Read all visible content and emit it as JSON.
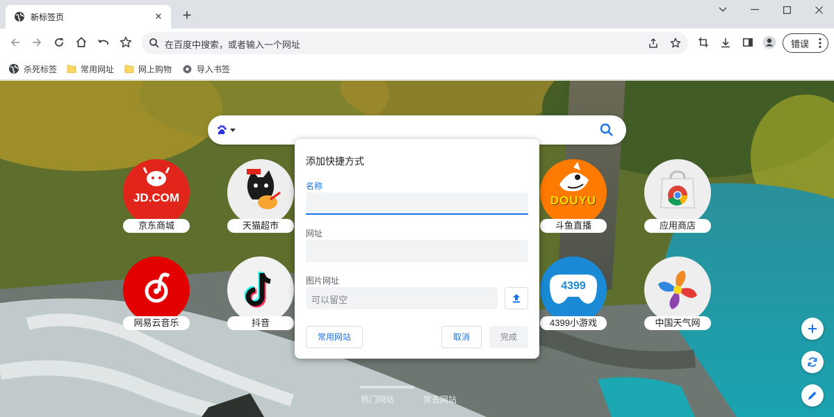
{
  "tab": {
    "title": "新标签页",
    "close": "✕"
  },
  "omnibox": {
    "placeholder": "在百度中搜索，或者输入一个网址"
  },
  "profile": {
    "error_label": "错误"
  },
  "bookmarks": [
    {
      "label": "杀死标签",
      "icon": "globe-icon"
    },
    {
      "label": "常用网址",
      "icon": "folder-icon"
    },
    {
      "label": "网上购物",
      "icon": "folder-icon"
    },
    {
      "label": "导入书签",
      "icon": "gear-icon"
    }
  ],
  "shortcuts": [
    {
      "name": "京东商城",
      "logo_text": "JD.COM",
      "color": "#e1251b"
    },
    {
      "name": "天猫超市",
      "color": "#eeeeee"
    },
    {
      "name": "斗鱼直播",
      "logo_text": "DOUYU",
      "color": "#ff7a00"
    },
    {
      "name": "应用商店",
      "color": "#eeeeee"
    },
    {
      "name": "网易云音乐",
      "color": "#e20000"
    },
    {
      "name": "抖音",
      "color": "#f2f2f2"
    },
    {
      "name": "4399小游戏",
      "logo_text": "4399",
      "color": "#1a8ad6"
    },
    {
      "name": "中国天气网",
      "color": "#eeeeee"
    }
  ],
  "bottom_tabs": [
    "热门网站",
    "常去网站"
  ],
  "dialog": {
    "title": "添加快捷方式",
    "name_label": "名称",
    "name_value": "",
    "url_label": "网址",
    "url_value": "",
    "image_label": "图片网址",
    "image_placeholder": "可以留空",
    "common_sites_button": "常用网站",
    "cancel_button": "取消",
    "done_button": "完成"
  },
  "colors": {
    "accent": "#1a73e8",
    "tabstrip": "#dee1e6",
    "omnibox": "#f1f3f4"
  }
}
